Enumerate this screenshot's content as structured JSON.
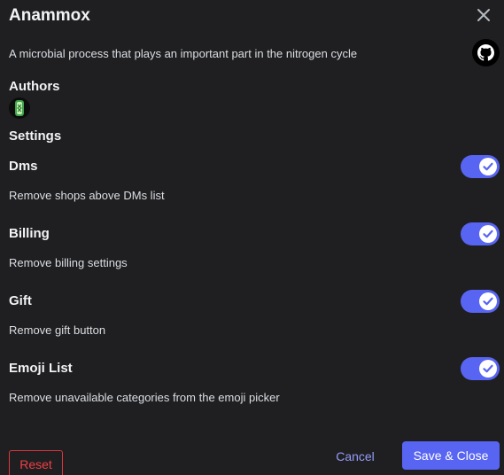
{
  "modal": {
    "title": "Anammox",
    "description": "A microbial process that plays an important part in the nitrogen cycle"
  },
  "authors": {
    "heading": "Authors"
  },
  "settings": {
    "heading": "Settings",
    "items": [
      {
        "label": "Dms",
        "description": "Remove shops above DMs list",
        "enabled": true
      },
      {
        "label": "Billing",
        "description": "Remove billing settings",
        "enabled": true
      },
      {
        "label": "Gift",
        "description": "Remove gift button",
        "enabled": true
      },
      {
        "label": "Emoji List",
        "description": "Remove unavailable categories from the emoji picker",
        "enabled": true
      }
    ]
  },
  "footer": {
    "reset_label": "Reset",
    "cancel_label": "Cancel",
    "save_label": "Save & Close"
  },
  "colors": {
    "background": "#1f1f22",
    "accent": "#5865f2",
    "danger": "#f23f43",
    "link": "#949cf7"
  },
  "icons": {
    "close": "close-icon",
    "github": "github-icon",
    "toggle_check": "check-icon"
  }
}
